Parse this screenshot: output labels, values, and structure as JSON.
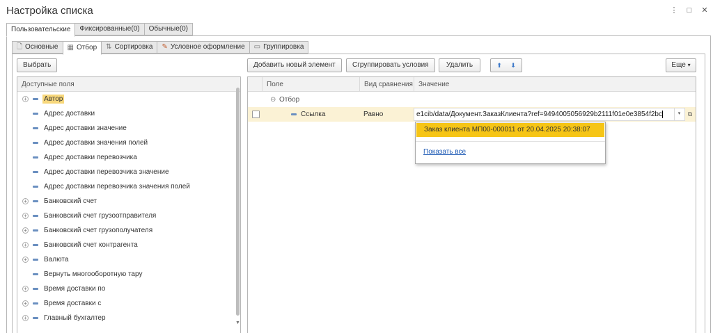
{
  "window": {
    "title": "Настройка списка",
    "menu_glyph": "⋮",
    "maximize_glyph": "□",
    "close_glyph": "✕"
  },
  "top_tabs": [
    {
      "label": "Пользовательские",
      "active": true
    },
    {
      "label": "Фиксированные(0)",
      "active": false
    },
    {
      "label": "Обычные(0)",
      "active": false
    }
  ],
  "inner_tabs": [
    {
      "label": "Основные",
      "icon": "page-icon"
    },
    {
      "label": "Отбор",
      "icon": "filter-icon",
      "active": true
    },
    {
      "label": "Сортировка",
      "icon": "sort-icon"
    },
    {
      "label": "Условное оформление",
      "icon": "conditional-format-icon"
    },
    {
      "label": "Группировка",
      "icon": "grouping-icon"
    }
  ],
  "left": {
    "select_button": "Выбрать",
    "header": "Доступные поля",
    "items": [
      {
        "label": "Автор",
        "expandable": true,
        "selected": true
      },
      {
        "label": "Адрес доставки",
        "expandable": false
      },
      {
        "label": "Адрес доставки значение",
        "expandable": false
      },
      {
        "label": "Адрес доставки значения полей",
        "expandable": false
      },
      {
        "label": "Адрес доставки перевозчика",
        "expandable": false
      },
      {
        "label": "Адрес доставки перевозчика значение",
        "expandable": false
      },
      {
        "label": "Адрес доставки перевозчика значения полей",
        "expandable": false
      },
      {
        "label": "Банковский счет",
        "expandable": true
      },
      {
        "label": "Банковский счет грузоотправителя",
        "expandable": true
      },
      {
        "label": "Банковский счет грузополучателя",
        "expandable": true
      },
      {
        "label": "Банковский счет контрагента",
        "expandable": true
      },
      {
        "label": "Валюта",
        "expandable": true
      },
      {
        "label": "Вернуть многооборотную тару",
        "expandable": false
      },
      {
        "label": "Время доставки по",
        "expandable": true
      },
      {
        "label": "Время доставки с",
        "expandable": true
      },
      {
        "label": "Главный бухгалтер",
        "expandable": true
      }
    ]
  },
  "right": {
    "toolbar": {
      "add_button": "Добавить новый элемент",
      "group_button": "Сгруппировать условия",
      "delete_button": "Удалить",
      "more_button": "Еще",
      "more_arrow": "▾",
      "move_up_glyph": "⬆",
      "move_down_glyph": "⬇"
    },
    "columns": {
      "field": "Поле",
      "comparison": "Вид сравнения",
      "value": "Значение"
    },
    "group_row": {
      "collapse_glyph": "⊖",
      "label": "Отбор"
    },
    "condition_row": {
      "field": "Ссылка",
      "comparison": "Равно",
      "value": "e1cib/data/Документ.ЗаказКлиента?ref=9494005056929b2111f01e0e3854f2bc"
    }
  },
  "popup": {
    "suggestion": "Заказ клиента МП00-000011 от 20.04.2025 20:38:07",
    "show_all": "Показать все"
  },
  "colors": {
    "selection": "#f7d77b",
    "popup_highlight": "#f6c516",
    "row_highlight": "#fbf2d5",
    "link": "#1f5bb5",
    "arrow": "#3b78c9"
  }
}
